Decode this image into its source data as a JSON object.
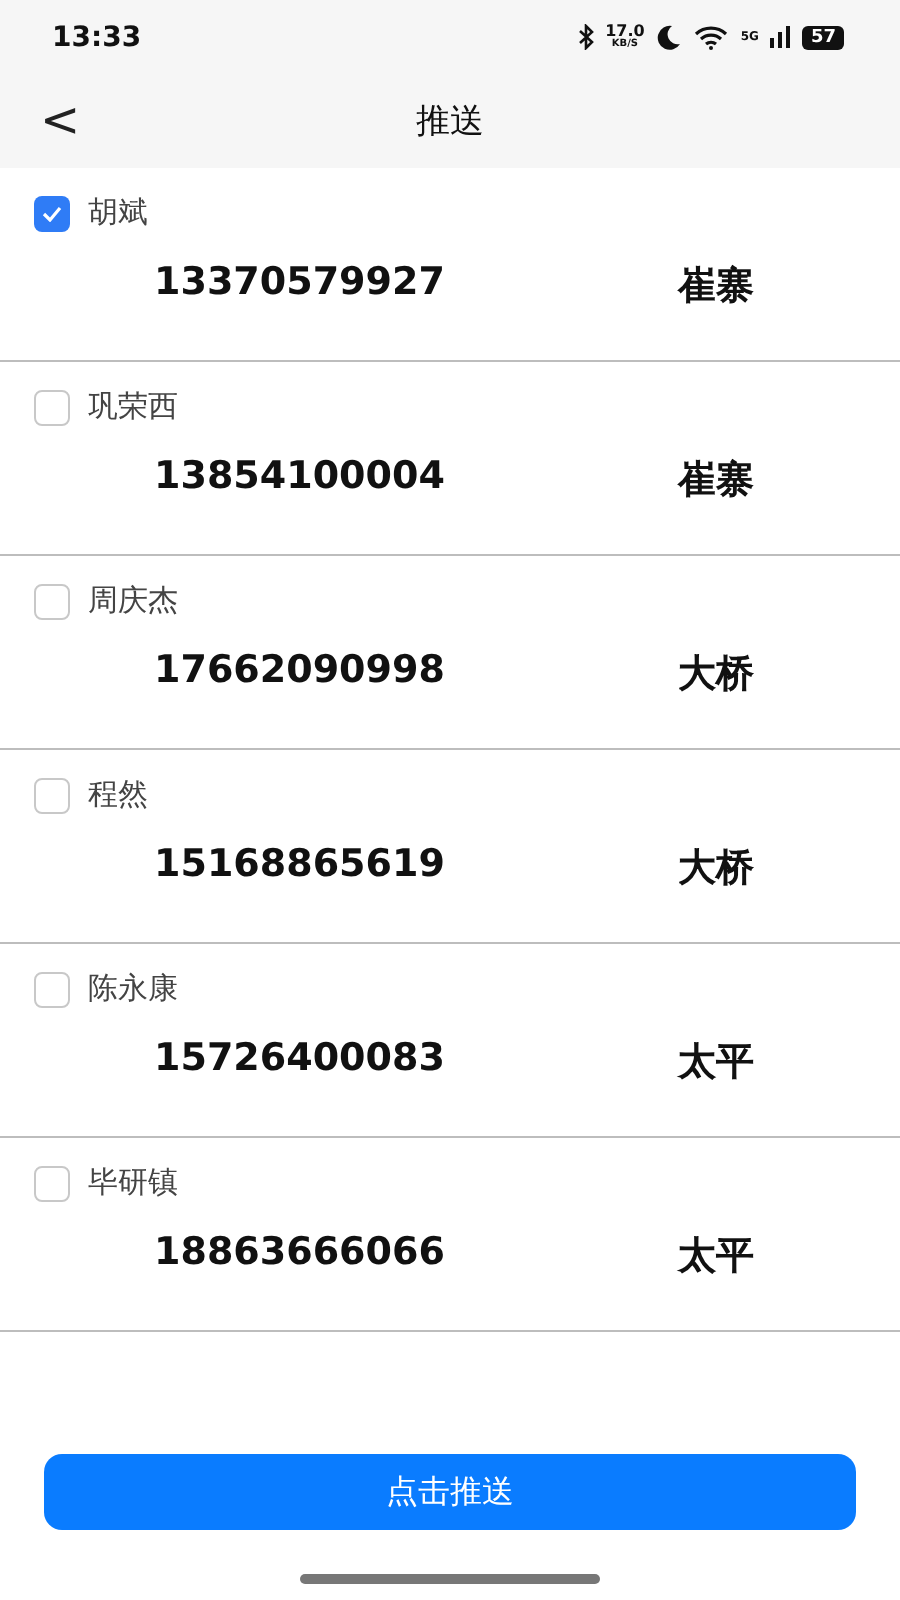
{
  "status_bar": {
    "time": "13:33",
    "speed": "17.0",
    "speed_unit": "KB/S",
    "network": "5G",
    "battery": "57"
  },
  "nav": {
    "back": "<",
    "title": "推送"
  },
  "contacts": [
    {
      "name": "胡斌",
      "phone": "13370579927",
      "place": "崔寨",
      "selected": true
    },
    {
      "name": "巩荣西",
      "phone": "13854100004",
      "place": "崔寨",
      "selected": false
    },
    {
      "name": "周庆杰",
      "phone": "17662090998",
      "place": "大桥",
      "selected": false
    },
    {
      "name": "程然",
      "phone": "15168865619",
      "place": "大桥",
      "selected": false
    },
    {
      "name": "陈永康",
      "phone": "15726400083",
      "place": "太平",
      "selected": false
    },
    {
      "name": "毕研镇",
      "phone": "18863666066",
      "place": "太平",
      "selected": false
    }
  ],
  "push_button": "点击推送"
}
